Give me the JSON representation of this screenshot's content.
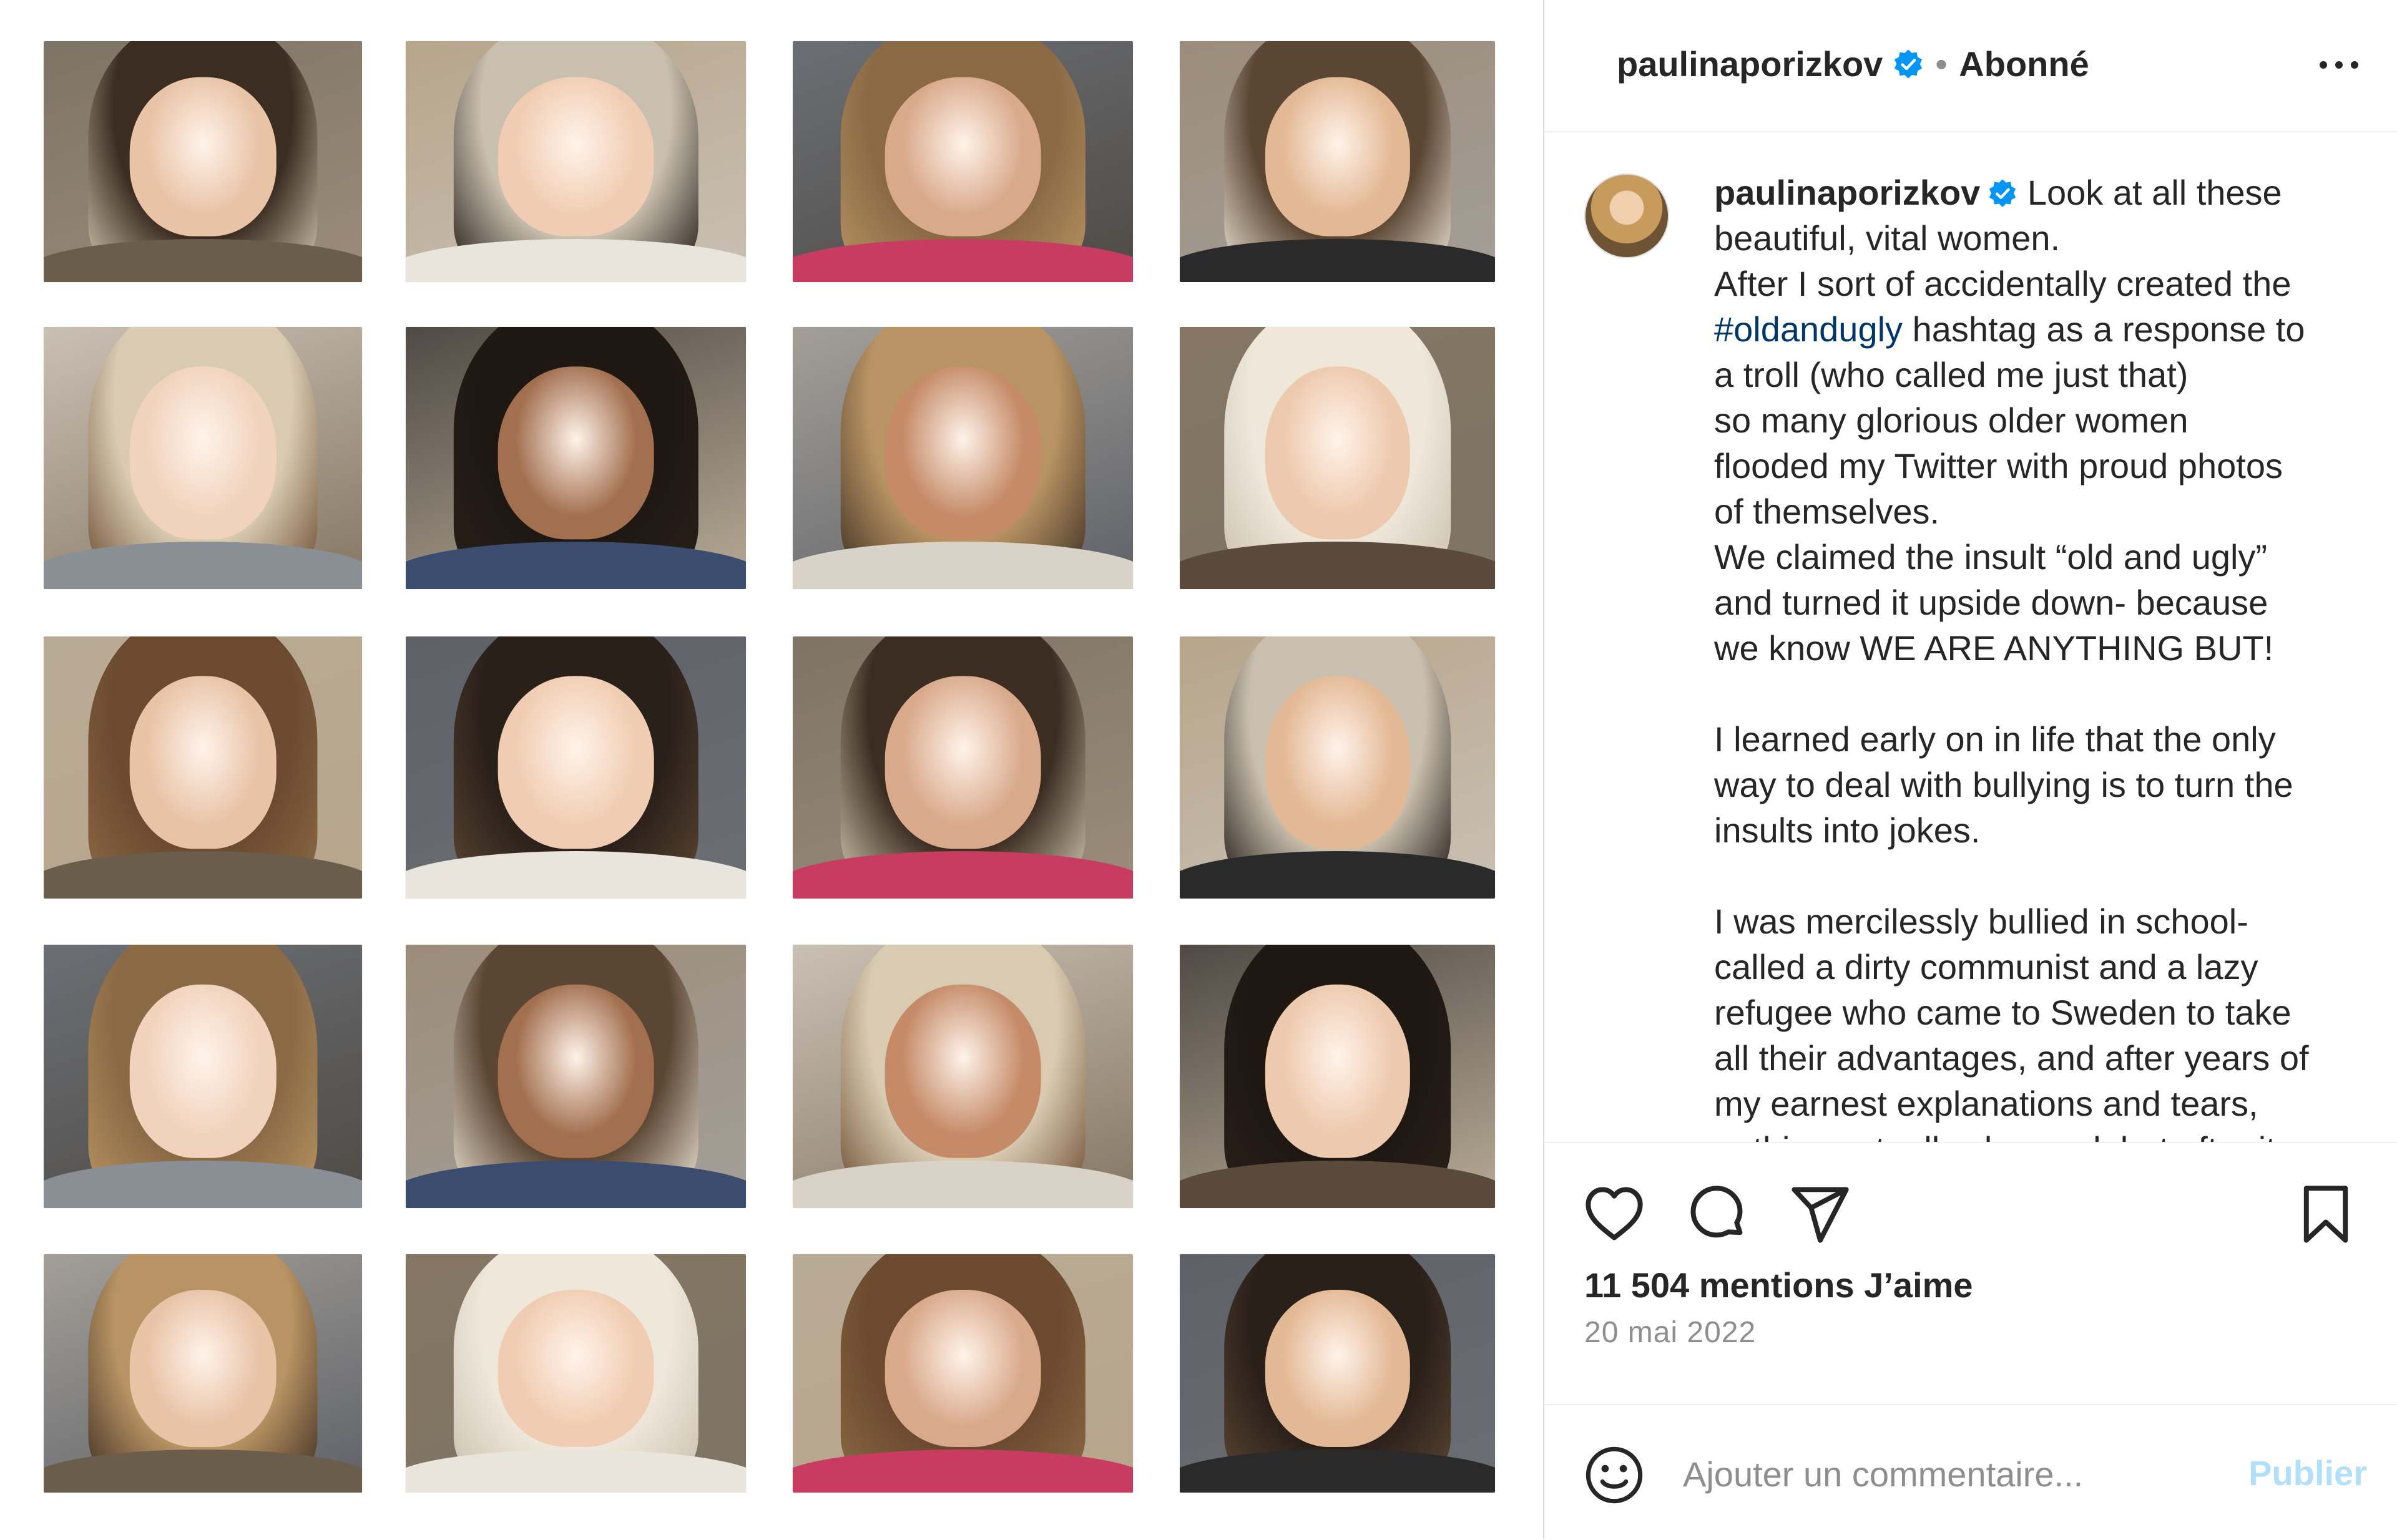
{
  "colors": {
    "verified_badge": "#0095f6",
    "hashtag": "#00376b",
    "publish_disabled": "#b2dffc",
    "muted": "#8e8e8e"
  },
  "collage": {
    "description_icon": "photo-grid",
    "tile_count": 20
  },
  "header": {
    "username": "paulinaporizkov",
    "separator": "•",
    "follow_label": "Abonné",
    "more_icon": "more-options-icon"
  },
  "caption": {
    "username": "paulinaporizkov",
    "text_before_tag": " Look at all these\nbeautiful, vital women.\nAfter I sort of accidentally created the\n",
    "hashtag": "#oldandugly",
    "text_after_tag": " hashtag as a response to\na troll (who called me just that)\nso many glorious older women\nflooded my Twitter with proud photos\nof themselves.\nWe claimed the insult “old and ugly”\nand turned it upside down- because\nwe know WE ARE ANYTHING BUT!\n\nI learned early on in life that the only\nway to deal with bullying is to turn the\ninsults into jokes.\n\nI was mercilessly bullied in school-\ncalled a dirty communist and a lazy\nrefugee who came to Sweden to take\nall their advantages, and after years of\nmy earnest explanations and tears,\nnothing actually changed, but after it"
  },
  "actions": {
    "likes_label": "11 504 mentions J’aime",
    "date": "20 mai 2022"
  },
  "comment": {
    "placeholder": "Ajouter un commentaire...",
    "publish_label": "Publier"
  }
}
